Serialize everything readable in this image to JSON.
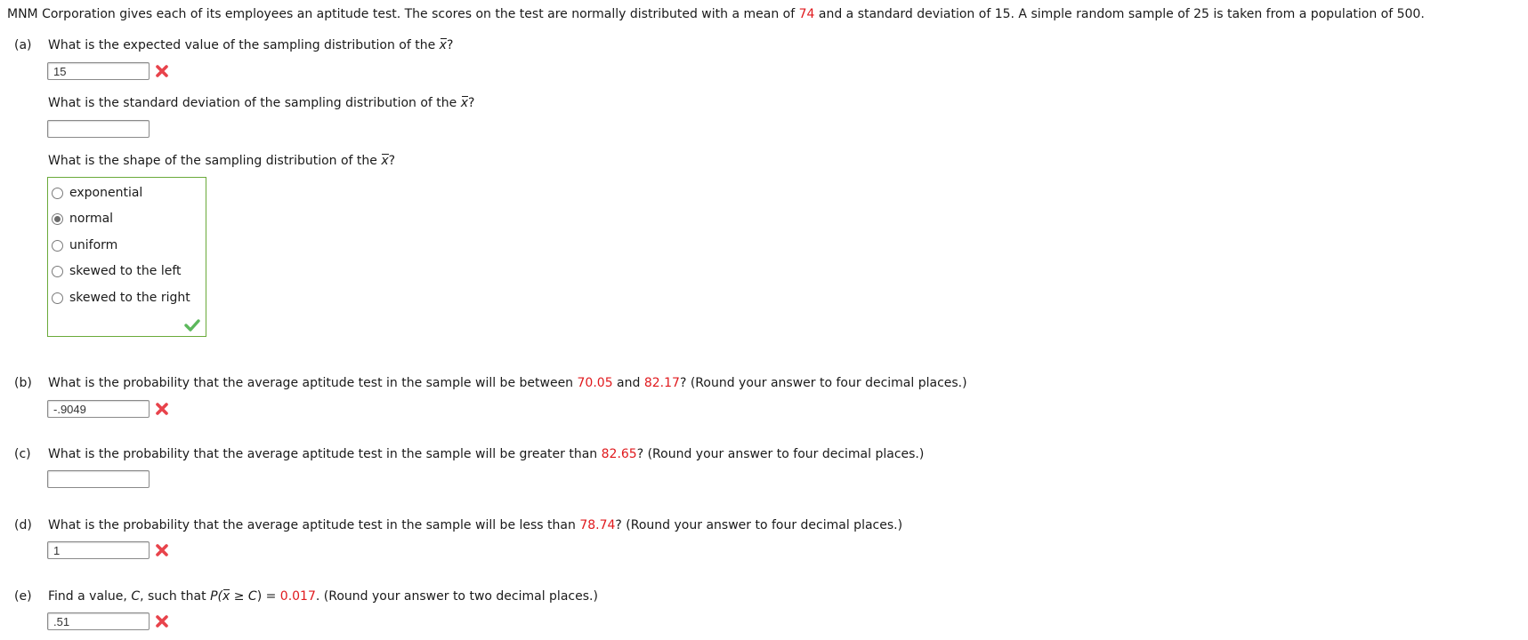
{
  "intro": {
    "before_mean": "MNM Corporation gives each of its employees an aptitude test. The scores on the test are normally distributed with a mean of ",
    "mean": "74",
    "after_mean": " and a standard deviation of 15. A simple random sample of 25 is taken from a population of 500."
  },
  "colors": {
    "highlight": "#e0191d",
    "correct_border": "#6aaa3a",
    "check": "#5cb85c",
    "wrong_x": "#e8434b"
  },
  "part_a": {
    "label": "(a)",
    "q1_text": "What is the expected value of the sampling distribution of the ",
    "xbar": "x",
    "q_mark": "?",
    "q1_answer": "15",
    "q1_status": "incorrect",
    "q2_text": "What is the standard deviation of the sampling distribution of the ",
    "q2_answer": "",
    "q3_text": "What is the shape of the sampling distribution of the ",
    "options": [
      {
        "label": "exponential",
        "checked": false
      },
      {
        "label": "normal",
        "checked": true
      },
      {
        "label": "uniform",
        "checked": false
      },
      {
        "label": "skewed to the left",
        "checked": false
      },
      {
        "label": "skewed to the right",
        "checked": false
      }
    ],
    "q3_status": "correct"
  },
  "part_b": {
    "label": "(b)",
    "text1": "What is the probability that the average aptitude test in the sample will be between ",
    "low": "70.05",
    "text2": " and ",
    "high": "82.17",
    "text3": "? (Round your answer to four decimal places.)",
    "answer": "-.9049",
    "status": "incorrect"
  },
  "part_c": {
    "label": "(c)",
    "text1": "What is the probability that the average aptitude test in the sample will be greater than ",
    "value": "82.65",
    "text2": "? (Round your answer to four decimal places.)",
    "answer": ""
  },
  "part_d": {
    "label": "(d)",
    "text1": "What is the probability that the average aptitude test in the sample will be less than ",
    "value": "78.74",
    "text2": "? (Round your answer to four decimal places.)",
    "answer": "1",
    "status": "incorrect"
  },
  "part_e": {
    "label": "(e)",
    "text1": "Find a value, ",
    "c_var": "C",
    "text2": ", such that ",
    "p_open": "P(",
    "xbar": "x",
    "ge": " ≥ ",
    "c_close": "C",
    "paren_close": ")",
    "eq": " = ",
    "prob": "0.017",
    "text3": ". (Round your answer to two decimal places.)",
    "answer": ".51",
    "status": "incorrect"
  }
}
